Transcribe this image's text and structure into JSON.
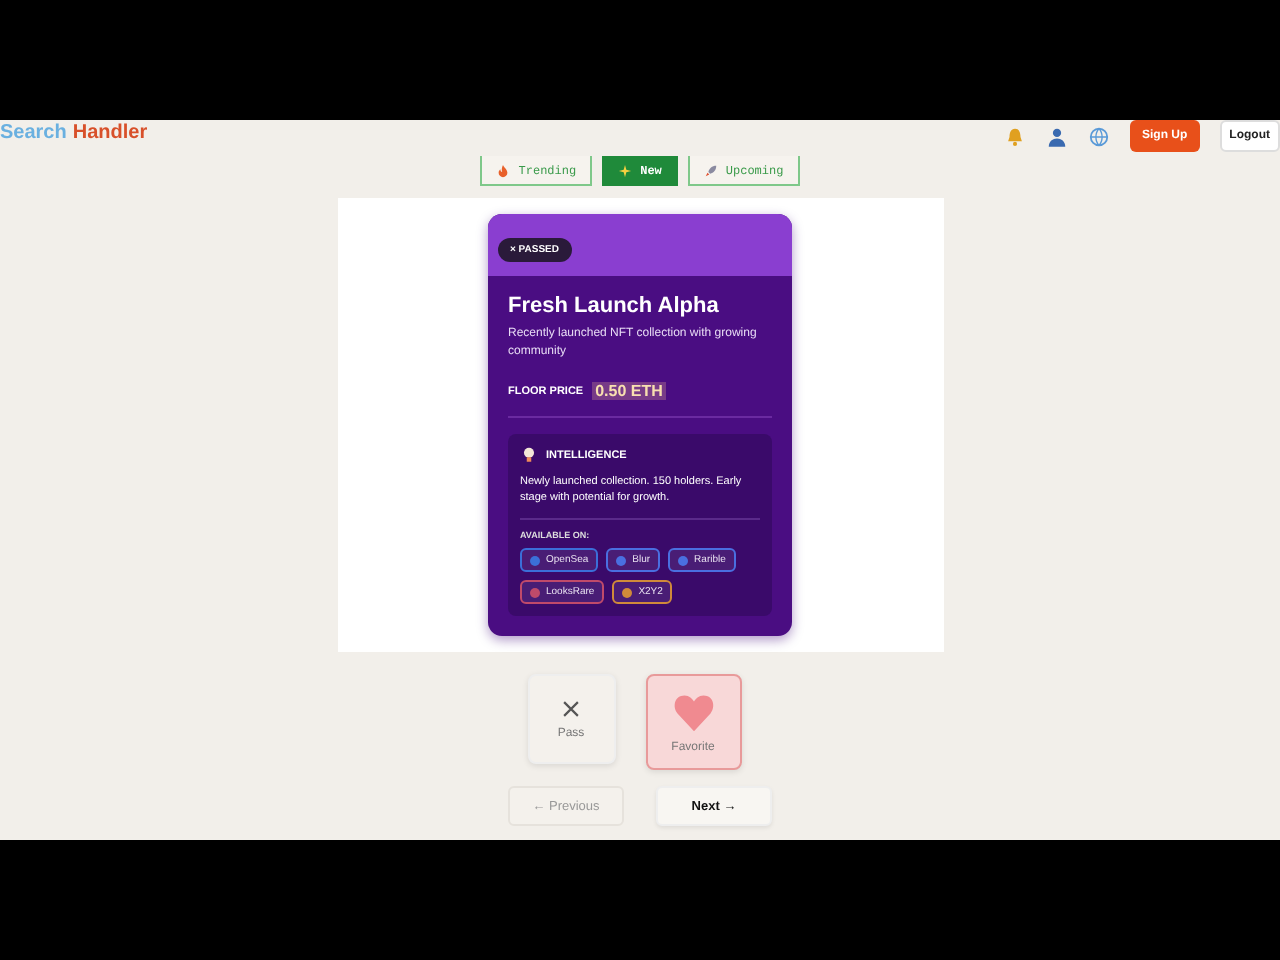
{
  "brand": {
    "part1": "Search",
    "part2": "Handler"
  },
  "header": {
    "signup": "Sign Up",
    "logout": "Logout"
  },
  "tabs": [
    {
      "label": "Trending",
      "kind": "fire",
      "selected": false
    },
    {
      "label": "New",
      "kind": "sparkle",
      "selected": true
    },
    {
      "label": "Upcoming",
      "kind": "rocket",
      "selected": false
    }
  ],
  "card": {
    "badge": "× PASSED",
    "title": "Fresh Launch Alpha",
    "description": "Recently launched NFT collection with growing community",
    "floor_label": "FLOOR PRICE",
    "floor_value": "0.50 ETH",
    "intelligence": {
      "heading": "INTELLIGENCE",
      "text": "Newly launched collection. 150 holders. Early stage with potential for growth.",
      "available_label": "AVAILABLE ON:",
      "markets": [
        {
          "name": "OpenSea",
          "color": "#3b6fd8"
        },
        {
          "name": "Blur",
          "color": "#4a6fe0"
        },
        {
          "name": "Rarible",
          "color": "#4a6fe0"
        },
        {
          "name": "LooksRare",
          "color": "#c04a6a"
        },
        {
          "name": "X2Y2",
          "color": "#d08a3a"
        }
      ]
    }
  },
  "actions": [
    {
      "kind": "pass",
      "label": "Pass",
      "selected": false
    },
    {
      "kind": "favorite",
      "label": "Favorite",
      "selected": true
    }
  ],
  "nav": [
    {
      "label": "← Previous",
      "disabled": true
    },
    {
      "label": "Next →",
      "disabled": false
    }
  ]
}
